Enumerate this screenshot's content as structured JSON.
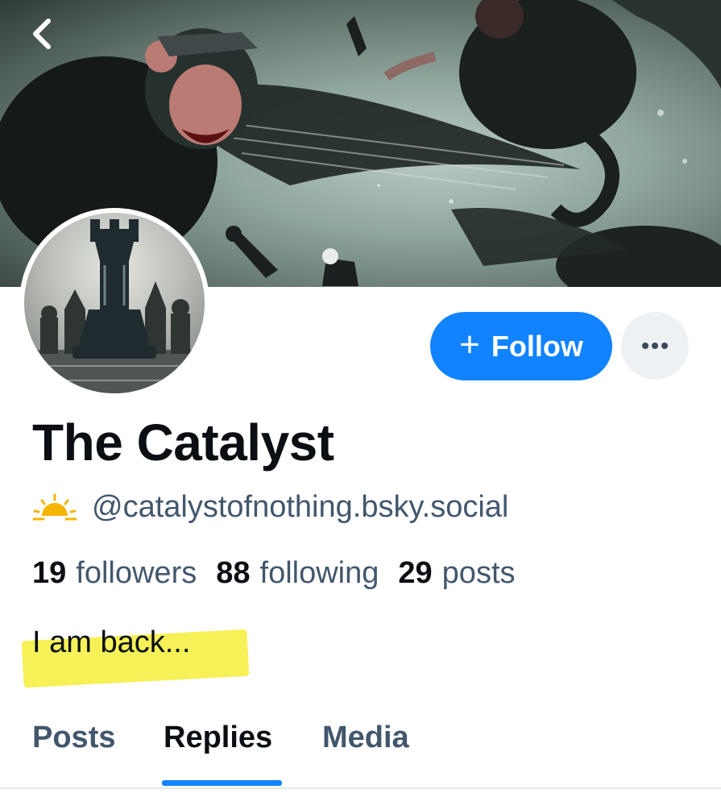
{
  "profile": {
    "display_name": "The Catalyst",
    "handle": "@catalystofnothing.bsky.social",
    "bio": "I am back..."
  },
  "actions": {
    "follow_label": "Follow",
    "follow_icon": "plus-icon",
    "more_icon": "ellipsis-icon"
  },
  "stats": {
    "followers_count": "19",
    "followers_label": "followers",
    "following_count": "88",
    "following_label": "following",
    "posts_count": "29",
    "posts_label": "posts"
  },
  "tabs": [
    {
      "label": "Posts",
      "active": false
    },
    {
      "label": "Replies",
      "active": true
    },
    {
      "label": "Media",
      "active": false
    }
  ],
  "icons": {
    "back": "chevron-left-icon",
    "handle_badge": "sun-icon"
  },
  "colors": {
    "accent": "#1183fe",
    "text_primary": "#0b0f14",
    "text_secondary": "#42576c",
    "highlight": "#f3ee3a",
    "sun_badge": "#f5b400"
  }
}
